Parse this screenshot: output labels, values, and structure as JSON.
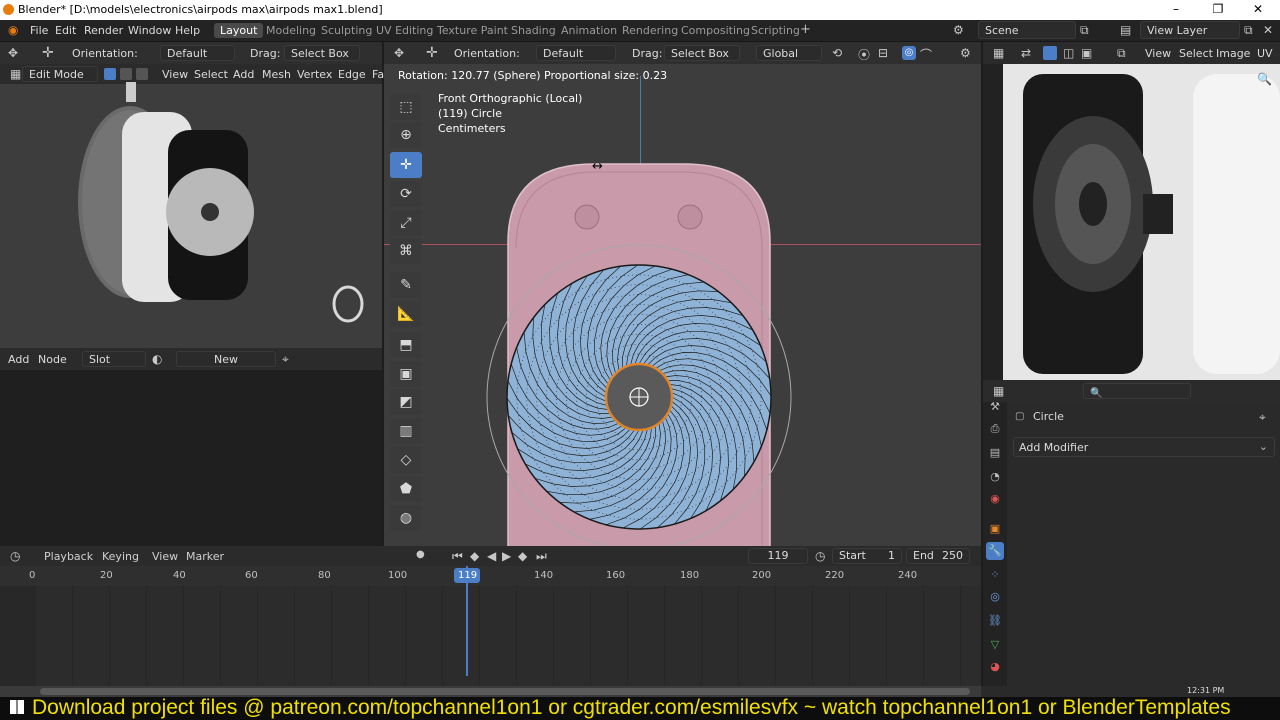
{
  "window": {
    "title": "Blender* [D:\\models\\electronics\\airpods max\\airpods max1.blend]"
  },
  "menu": [
    "File",
    "Edit",
    "Render",
    "Window",
    "Help"
  ],
  "workspaces": [
    "Layout",
    "Modeling",
    "Sculpting",
    "UV Editing",
    "Texture Paint",
    "Shading",
    "Animation",
    "Rendering",
    "Compositing",
    "Scripting"
  ],
  "scene": {
    "name": "Scene",
    "view_layer": "View Layer"
  },
  "left_header": {
    "orientation_label": "Orientation:",
    "orientation_value": "Default",
    "drag_label": "Drag:",
    "drag_value": "Select Box"
  },
  "left_view_header": {
    "mode": "Edit Mode",
    "view": "View",
    "select": "Select",
    "add": "Add",
    "mesh": "Mesh",
    "vertex": "Vertex",
    "edge": "Edge",
    "face": "Fa"
  },
  "node_header": {
    "add": "Add",
    "node": "Node",
    "slot": "Slot",
    "new": "New"
  },
  "main_header": {
    "orientation_label": "Orientation:",
    "orientation_value": "Default",
    "drag_label": "Drag:",
    "drag_value": "Select Box",
    "transform": "Global"
  },
  "viewport": {
    "status": "Rotation: 120.77 (Sphere) Proportional size: 0.23",
    "view_name": "Front Orthographic (Local)",
    "object": "(119) Circle",
    "units": "Centimeters"
  },
  "image_header": {
    "view": "View",
    "select": "Select",
    "image": "Image",
    "uv": "UV"
  },
  "properties": {
    "object_name": "Circle",
    "add_modifier": "Add Modifier"
  },
  "timeline": {
    "playback": "Playback",
    "keying": "Keying",
    "view": "View",
    "marker": "Marker",
    "current_frame": "119",
    "start_label": "Start",
    "start": "1",
    "end_label": "End",
    "end": "250",
    "ticks": [
      "0",
      "20",
      "40",
      "60",
      "80",
      "100",
      "119",
      "140",
      "160",
      "180",
      "200",
      "220",
      "240"
    ]
  },
  "taskbar": {
    "time": "12:31 PM"
  },
  "banner": "Download project files @ patreon.com/topchannel1on1 or cgtrader.com/esmilesvfx  ~ watch topchannel1on1 or BlenderTemplates",
  "colors": {
    "accent": "#4b7ec7",
    "active_face": "#8fb3d6",
    "mesh_pink": "#c89aaa",
    "frame_cursor": "#4b7ec7",
    "banner_text": "#f0e000"
  }
}
